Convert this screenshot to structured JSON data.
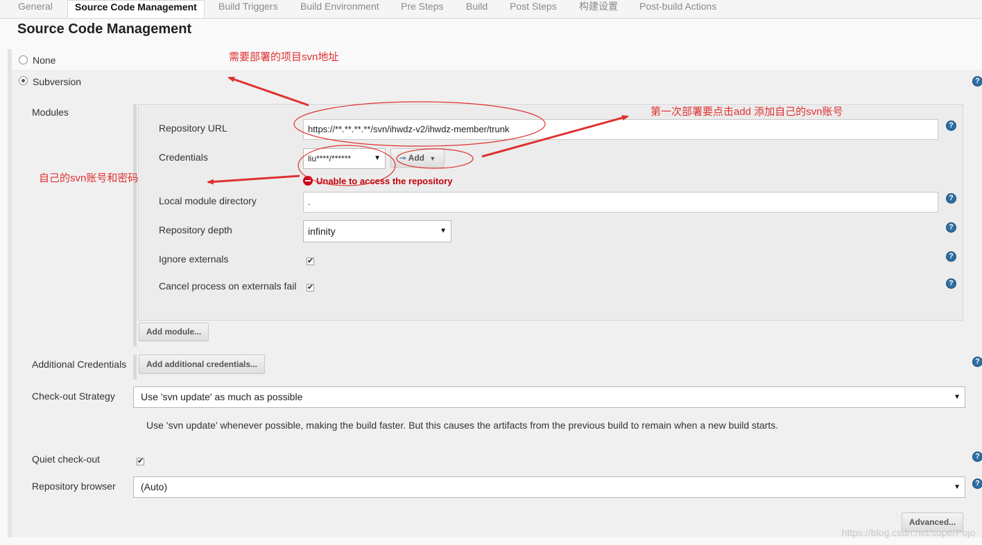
{
  "tabs": [
    "General",
    "Source Code Management",
    "Build Triggers",
    "Build Environment",
    "Pre Steps",
    "Build",
    "Post Steps",
    "构建设置",
    "Post-build Actions"
  ],
  "section_title": "Source Code Management",
  "scm_options": {
    "none": "None",
    "subversion": "Subversion",
    "selected": "Subversion"
  },
  "modules": {
    "label": "Modules",
    "repository_url": {
      "label": "Repository URL",
      "value": "https://**.**.**.**/svn/ihwdz-v2/ihwdz-member/trunk"
    },
    "credentials": {
      "label": "Credentials",
      "selected": "liu****/******",
      "add_button": "Add",
      "error": "Unable to access the repository"
    },
    "local_module_directory": {
      "label": "Local module directory",
      "value": "."
    },
    "repository_depth": {
      "label": "Repository depth",
      "selected": "infinity"
    },
    "ignore_externals": {
      "label": "Ignore externals",
      "checked": true
    },
    "cancel_process": {
      "label": "Cancel process on externals fail",
      "checked": true
    },
    "add_module_button": "Add module..."
  },
  "additional_credentials": {
    "label": "Additional Credentials",
    "button": "Add additional credentials..."
  },
  "checkout_strategy": {
    "label": "Check-out Strategy",
    "selected": "Use 'svn update' as much as possible",
    "description": "Use 'svn update' whenever possible, making the build faster. But this causes the artifacts from the previous build to remain when a new build starts."
  },
  "quiet_checkout": {
    "label": "Quiet check-out",
    "checked": true
  },
  "repository_browser": {
    "label": "Repository browser",
    "selected": "(Auto)"
  },
  "advanced_button": "Advanced...",
  "help_glyph": "?",
  "check_glyph": "✔",
  "dropdown_glyph": "▼",
  "annotations": {
    "svn_address": "需要部署的项目svn地址",
    "first_deploy": "第一次部署要点击add 添加自己的svn账号",
    "own_account": "自己的svn账号和密码"
  },
  "watermark": "https://blog.csdn.net/superPojo",
  "colors": {
    "annotation": "#e03030",
    "error": "#c4000a",
    "help": "#2c6ea3"
  }
}
